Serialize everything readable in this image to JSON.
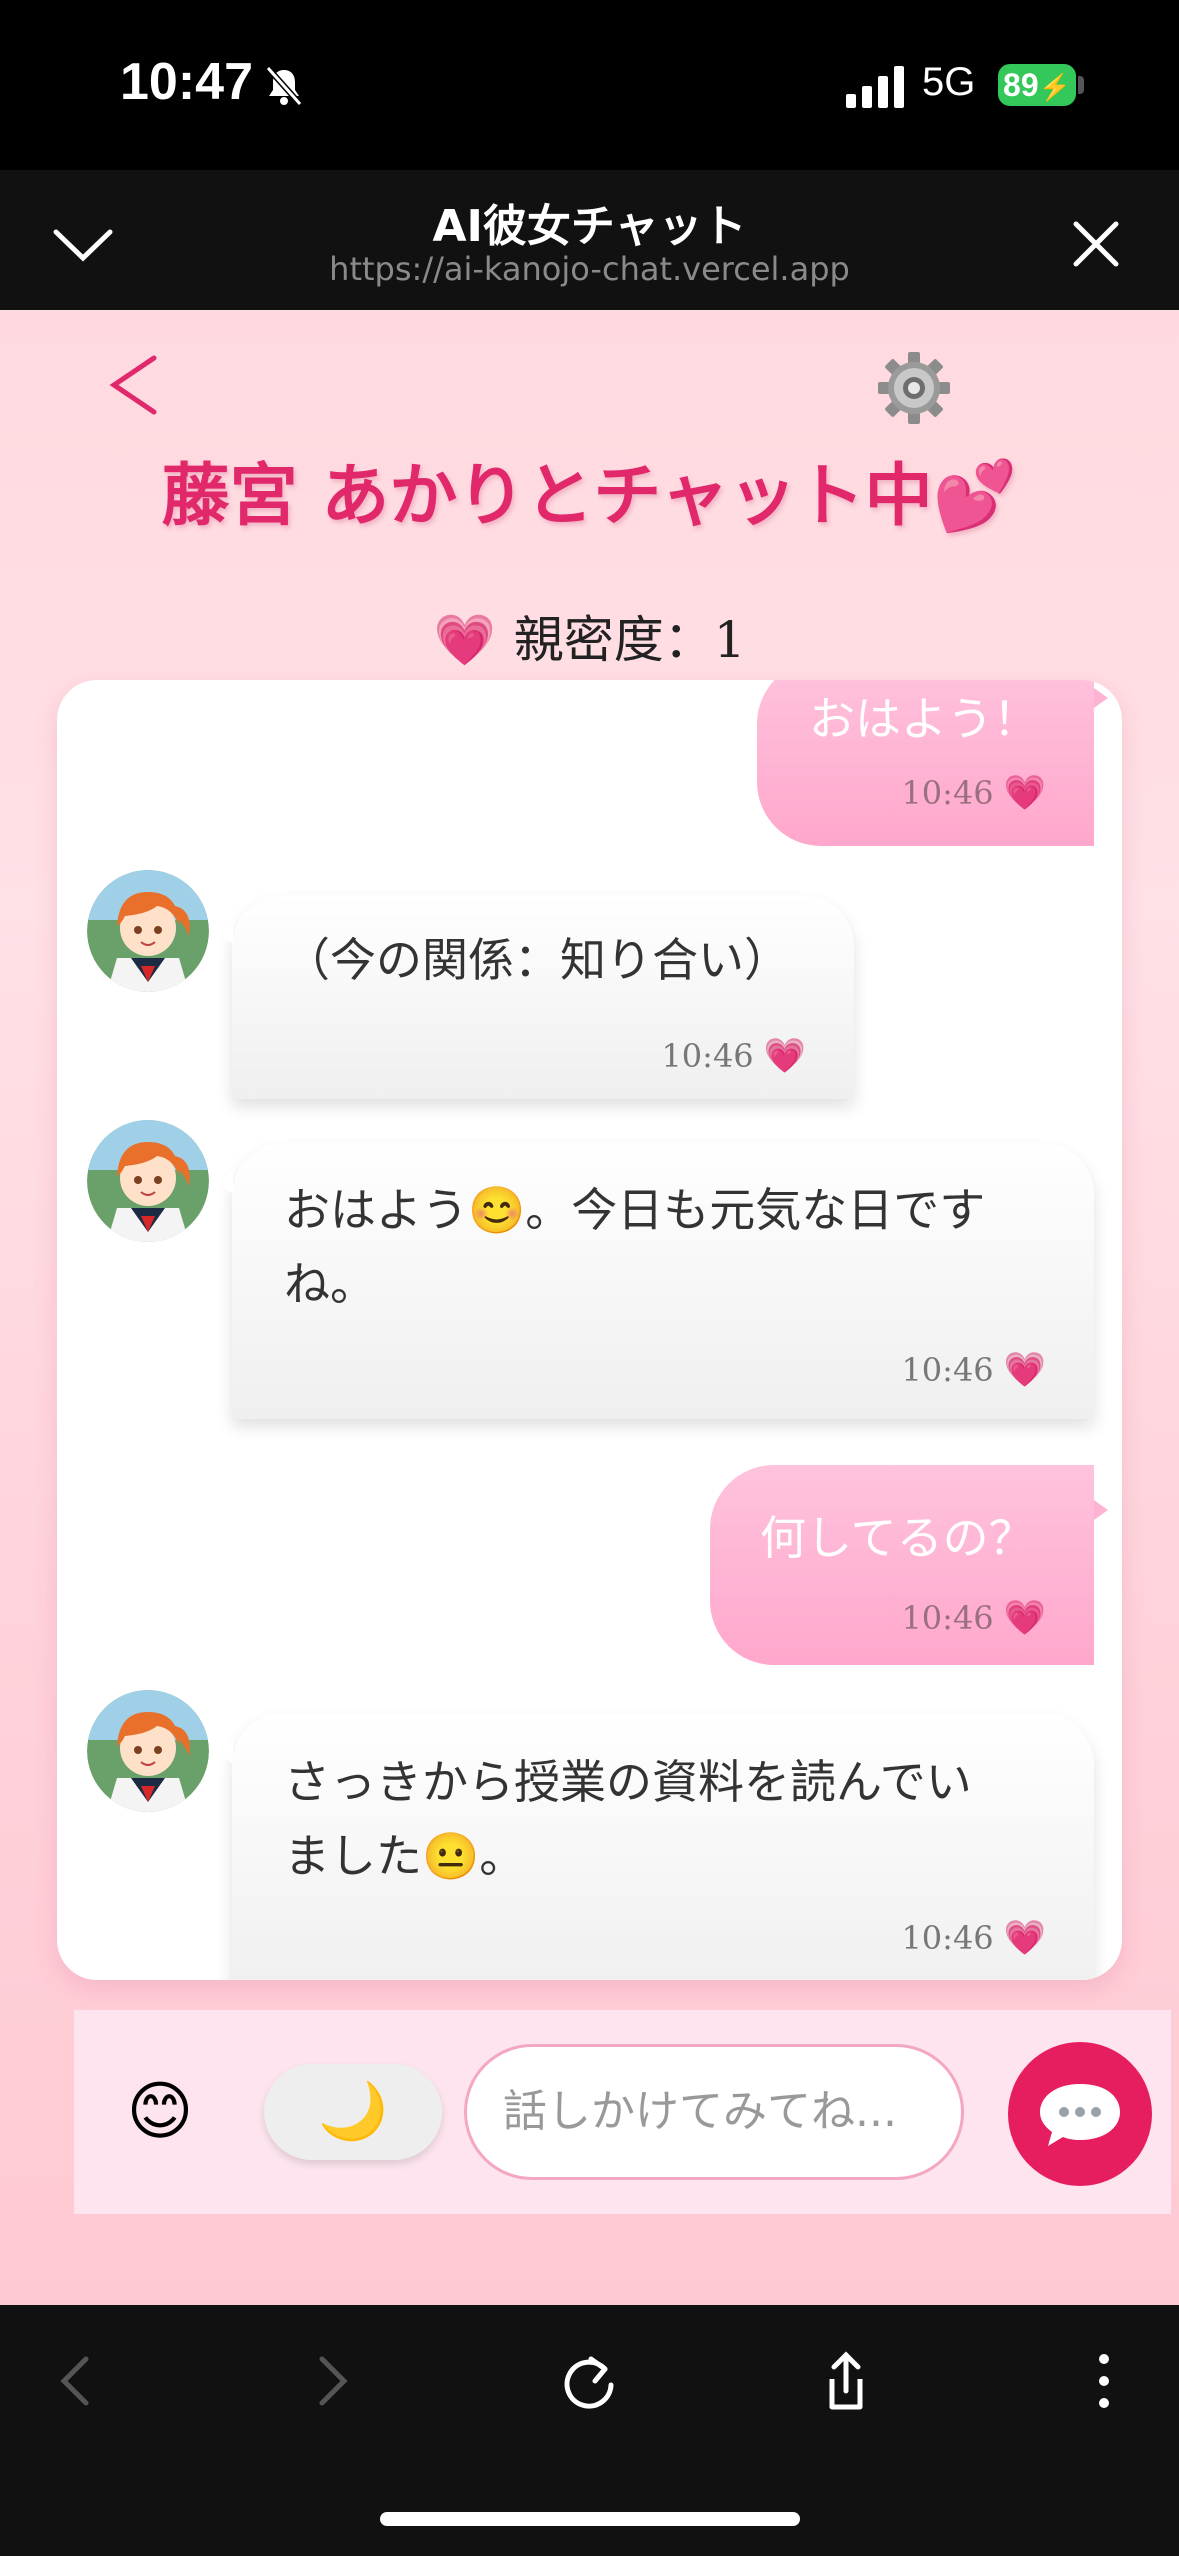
{
  "status_bar": {
    "time": "10:47",
    "network": "5G",
    "battery": "89"
  },
  "browser": {
    "title": "AI彼女チャット",
    "url": "https://ai-kanojo-chat.vercel.app"
  },
  "page": {
    "title": "藤宮 あかりとチャット中💕",
    "affinity_heart": "💗",
    "affinity_label": "親密度：1"
  },
  "messages": [
    {
      "sender": "user",
      "text": "おはよう！",
      "time": "10:46",
      "heart": "💗"
    },
    {
      "sender": "ai",
      "text": "（今の関係：知り合い）",
      "time": "10:46",
      "heart": "💗"
    },
    {
      "sender": "ai",
      "line1": "おはよう😊。今日も元気な日です",
      "line2": "ね。",
      "time": "10:46",
      "heart": "💗"
    },
    {
      "sender": "user",
      "text": "何してるの？",
      "time": "10:46",
      "heart": "💗"
    },
    {
      "sender": "ai",
      "line1": "さっきから授業の資料を読んでい",
      "line2": "ました😐。",
      "time": "10:46",
      "heart": "💗"
    }
  ],
  "input_bar": {
    "emoji": "😊",
    "moon": "🌙",
    "placeholder": "話しかけてみてね..."
  },
  "colors": {
    "accent": "#e61e5f",
    "title": "#e0286a",
    "user_bubble": "#ffb3d4",
    "battery": "#34c759"
  }
}
